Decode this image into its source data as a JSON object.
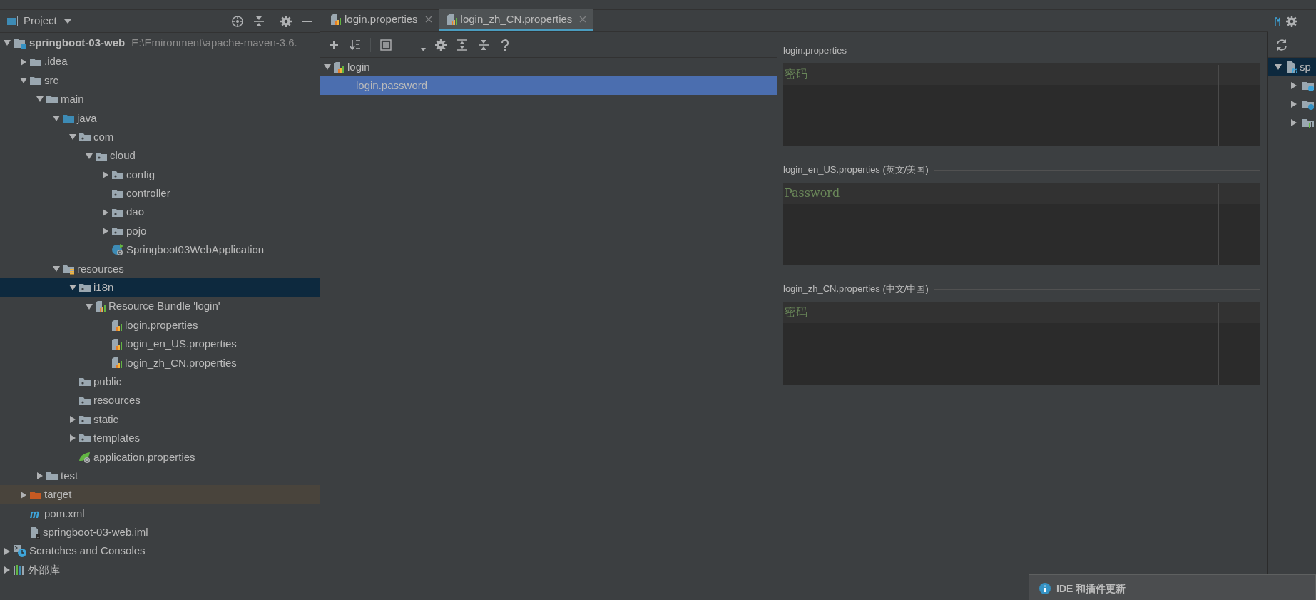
{
  "project_panel": {
    "title": "Project",
    "tree": [
      {
        "kind": "module",
        "label": "springboot-03-web",
        "path": "E:\\Emironment\\apache-maven-3.6.",
        "expanded": true,
        "selected": false,
        "children": [
          {
            "kind": "folder",
            "label": ".idea",
            "expanded": false,
            "selected": false
          },
          {
            "kind": "folder",
            "label": "src",
            "expanded": true,
            "selected": false,
            "children": [
              {
                "kind": "folder",
                "label": "main",
                "expanded": true,
                "selected": false,
                "children": [
                  {
                    "kind": "source-folder",
                    "label": "java",
                    "expanded": true,
                    "selected": false,
                    "children": [
                      {
                        "kind": "package",
                        "label": "com",
                        "expanded": true,
                        "selected": false,
                        "children": [
                          {
                            "kind": "package",
                            "label": "cloud",
                            "expanded": true,
                            "selected": false,
                            "children": [
                              {
                                "kind": "package",
                                "label": "config",
                                "expanded": false,
                                "selected": false
                              },
                              {
                                "kind": "package",
                                "label": "controller",
                                "selected": false
                              },
                              {
                                "kind": "package",
                                "label": "dao",
                                "expanded": false,
                                "selected": false
                              },
                              {
                                "kind": "package",
                                "label": "pojo",
                                "expanded": false,
                                "selected": false
                              },
                              {
                                "kind": "spring-class",
                                "label": "Springboot03WebApplication",
                                "selected": false
                              }
                            ]
                          }
                        ]
                      }
                    ]
                  },
                  {
                    "kind": "resources-folder",
                    "label": "resources",
                    "expanded": true,
                    "selected": false,
                    "children": [
                      {
                        "kind": "package",
                        "label": "i18n",
                        "expanded": true,
                        "selected": true,
                        "children": [
                          {
                            "kind": "bundle",
                            "label": "Resource Bundle 'login'",
                            "expanded": true,
                            "selected": false,
                            "children": [
                              {
                                "kind": "properties-file",
                                "label": "login.properties",
                                "selected": false
                              },
                              {
                                "kind": "properties-file",
                                "label": "login_en_US.properties",
                                "selected": false
                              },
                              {
                                "kind": "properties-file",
                                "label": "login_zh_CN.properties",
                                "selected": false
                              }
                            ]
                          }
                        ]
                      },
                      {
                        "kind": "package",
                        "label": "public",
                        "selected": false
                      },
                      {
                        "kind": "package",
                        "label": "resources",
                        "selected": false
                      },
                      {
                        "kind": "package",
                        "label": "static",
                        "expanded": false,
                        "selected": false
                      },
                      {
                        "kind": "package",
                        "label": "templates",
                        "expanded": false,
                        "selected": false
                      },
                      {
                        "kind": "spring-config",
                        "label": "application.properties",
                        "selected": false
                      }
                    ]
                  }
                ]
              },
              {
                "kind": "folder",
                "label": "test",
                "expanded": false,
                "selected": false
              }
            ]
          },
          {
            "kind": "excluded-folder",
            "label": "target",
            "expanded": false,
            "selected": false
          },
          {
            "kind": "maven",
            "label": "pom.xml",
            "selected": false
          },
          {
            "kind": "iml",
            "label": "springboot-03-web.iml",
            "selected": false
          }
        ]
      },
      {
        "kind": "scratches",
        "label": "Scratches and Consoles",
        "expanded": false,
        "selected": false
      },
      {
        "kind": "libraries",
        "label": "外部库",
        "expanded": false,
        "selected": false
      }
    ]
  },
  "editor_tabs": [
    {
      "label": "login.properties",
      "selected": false
    },
    {
      "label": "login_zh_CN.properties",
      "selected": true
    }
  ],
  "bundle_tree": {
    "label": "login",
    "expanded": true,
    "selected": false,
    "children": [
      {
        "label": "login.password",
        "selected": true
      }
    ]
  },
  "locale_values": [
    {
      "file": "login.properties",
      "value": "密码"
    },
    {
      "file": "login_en_US.properties (英文/美国)",
      "value": "Password"
    },
    {
      "file": "login_zh_CN.properties (中文/中国)",
      "value": "密码"
    }
  ],
  "maven_panel": {
    "root": {
      "label": "sp",
      "expanded": true,
      "selected": true
    },
    "children": [
      {
        "kind": "lifecycle",
        "expanded": false
      },
      {
        "kind": "plugins",
        "expanded": false
      },
      {
        "kind": "dependencies",
        "expanded": false
      }
    ]
  },
  "notification": {
    "title": "IDE 和插件更新"
  }
}
